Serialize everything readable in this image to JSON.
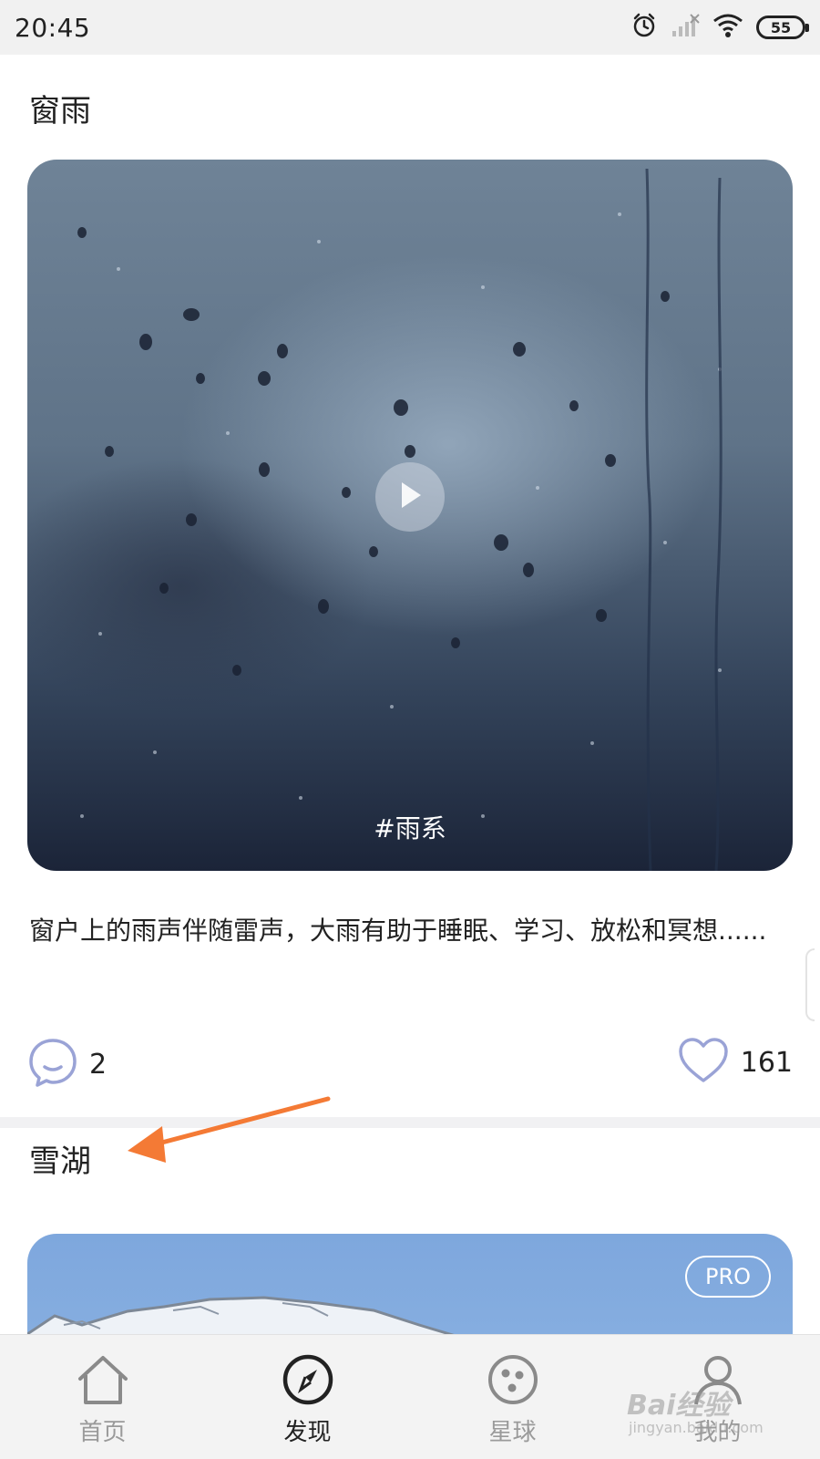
{
  "status_bar": {
    "time": "20:45",
    "battery": "55",
    "icons": [
      "alarm-icon",
      "signal-icon",
      "wifi-icon",
      "battery-icon"
    ]
  },
  "feed": {
    "posts": [
      {
        "title": "窗雨",
        "tag": "#雨系",
        "description": "窗户上的雨声伴随雷声，大雨有助于睡眠、学习、放松和冥想......",
        "comments": "2",
        "likes": "161"
      },
      {
        "title": "雪湖",
        "badge": "PRO"
      }
    ]
  },
  "tab_bar": {
    "tabs": [
      {
        "label": "首页",
        "icon": "home-icon"
      },
      {
        "label": "发现",
        "icon": "compass-icon",
        "active": true
      },
      {
        "label": "星球",
        "icon": "planet-icon"
      },
      {
        "label": "我的",
        "icon": "profile-icon"
      }
    ]
  },
  "watermark": {
    "text": "Bai经验",
    "sub": "jingyan.baidu.com"
  },
  "colors": {
    "accent_icon": "#9aa3d6",
    "arrow": "#f47a35"
  }
}
